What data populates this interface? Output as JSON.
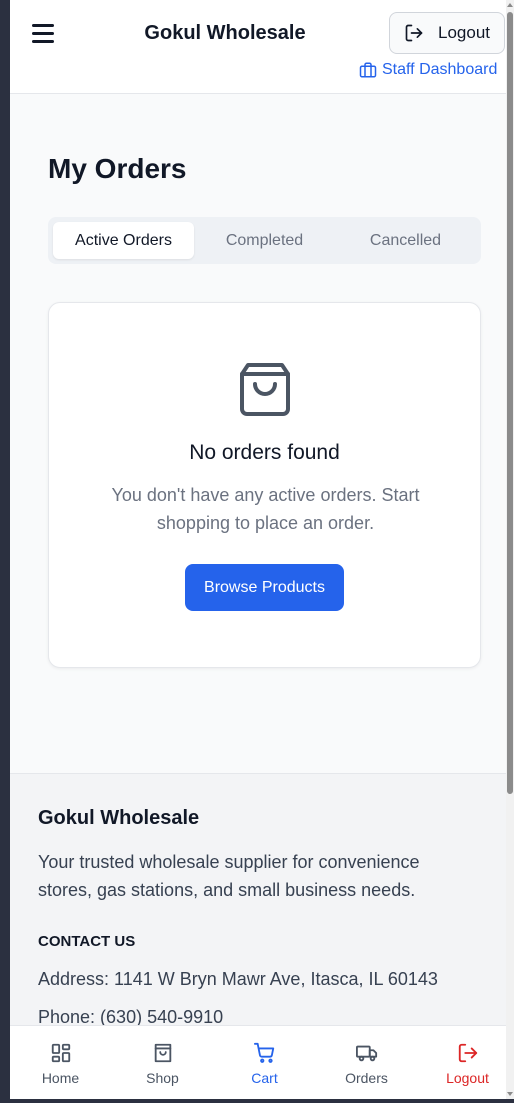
{
  "header": {
    "brand": "Gokul Wholesale",
    "logout_label": "Logout",
    "staff_dashboard_label": "Staff Dashboard"
  },
  "main": {
    "title": "My Orders",
    "tabs": [
      {
        "label": "Active Orders",
        "active": true
      },
      {
        "label": "Completed",
        "active": false
      },
      {
        "label": "Cancelled",
        "active": false
      }
    ],
    "empty_state": {
      "icon": "shopping-bag-icon",
      "title": "No orders found",
      "message": "You don't have any active orders. Start shopping to place an order.",
      "button_label": "Browse Products"
    }
  },
  "footer": {
    "brand": "Gokul Wholesale",
    "tagline": "Your trusted wholesale supplier for convenience stores, gas stations, and small business needs.",
    "contact_heading": "CONTACT US",
    "address": "Address: 1141 W Bryn Mawr Ave, Itasca, IL 60143",
    "phone": "Phone: (630) 540-9910"
  },
  "bottom_nav": [
    {
      "label": "Home",
      "icon": "grid-icon"
    },
    {
      "label": "Shop",
      "icon": "store-icon"
    },
    {
      "label": "Cart",
      "icon": "cart-icon",
      "active": true
    },
    {
      "label": "Orders",
      "icon": "truck-icon"
    },
    {
      "label": "Logout",
      "icon": "logout-icon",
      "color": "#dc2626"
    }
  ],
  "colors": {
    "accent": "#2563eb",
    "danger": "#dc2626",
    "text": "#111827",
    "muted": "#6b7280"
  }
}
